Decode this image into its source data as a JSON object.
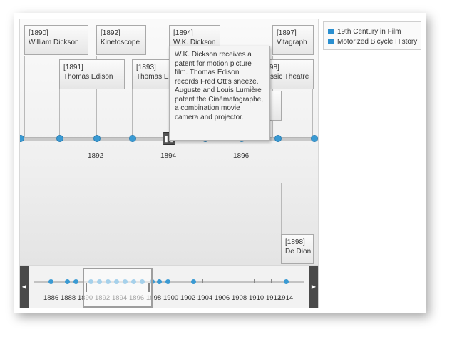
{
  "timeline": {
    "events": [
      {
        "year_tag": "[1890]",
        "title": "William Dickson"
      },
      {
        "year_tag": "[1892]",
        "title": "Kinetoscope"
      },
      {
        "year_tag": "[1894]",
        "title": "W.K. Dickson"
      },
      {
        "year_tag": "[1897]",
        "title": "Vitagraph"
      },
      {
        "year_tag": "[1891]",
        "title": "Thomas Edison"
      },
      {
        "year_tag": "[1893]",
        "title": "Thomas Edison"
      },
      {
        "year_tag": "[1898]",
        "title": "Classic Theatre"
      },
      {
        "year_tag": "",
        "title": "he"
      },
      {
        "year_tag": "[1898]",
        "title": "De Dion"
      }
    ],
    "axis_years": [
      "1892",
      "1894",
      "1896"
    ],
    "tooltip": "W.K. Dickson receives a patent for motion picture film. Thomas Edison records Fred Ott's sneeze. Auguste and Louis Lumière patent the Cinématographe, a combination movie camera and projector.",
    "pause_icon": "pause-icon"
  },
  "navigator": {
    "years": [
      "1886",
      "1888",
      "1890",
      "1892",
      "1894",
      "1896",
      "1898",
      "1900",
      "1902",
      "1904",
      "1906",
      "1908",
      "1910",
      "1912",
      "1914"
    ],
    "left_icon": "chevron-left-icon",
    "right_icon": "chevron-right-icon"
  },
  "legend": {
    "items": [
      {
        "label": "19th Century in Film",
        "color": "#2a8fd0"
      },
      {
        "label": "Motorized Bicycle History",
        "color": "#2a8fd0"
      }
    ]
  }
}
